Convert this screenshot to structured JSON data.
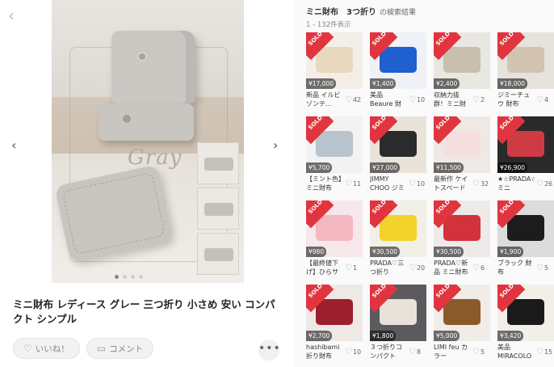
{
  "product": {
    "title": "ミニ財布 レディース グレー 三つ折り 小さめ 安い コンパクト シンプル",
    "photo_text": "Gray",
    "like_label": "いいね！",
    "comment_label": "コメント",
    "more_label": "•••"
  },
  "search": {
    "query": "ミニ財布　3つ折り",
    "suffix": "の検索結果",
    "count": "1 - 132件表示"
  },
  "sold_label": "SOLD",
  "items": [
    {
      "price": "¥17,000",
      "name": "新品 イルビゾンテ...",
      "likes": "42",
      "bg": "#f3efe8",
      "obj": "#e8d8be"
    },
    {
      "price": "¥1,400",
      "name": "美品　Beaure 財布",
      "likes": "10",
      "bg": "#eef1f6",
      "obj": "#1f5fcf"
    },
    {
      "price": "¥2,400",
      "name": "収納力抜群！ミニ財布",
      "likes": "2",
      "bg": "#e9e7e2",
      "obj": "#c8bfae"
    },
    {
      "price": "¥18,000",
      "name": "ジミーチュウ 財布",
      "likes": "4",
      "bg": "#e6e2dc",
      "obj": "#d2c4b0"
    },
    {
      "price": "¥5,700",
      "name": "【ミント色】ミニ財布",
      "likes": "11",
      "bg": "#f2f2f2",
      "obj": "#b8c3cb"
    },
    {
      "price": "¥27,000",
      "name": "JIMMY CHOO ジミーチュウ",
      "likes": "10",
      "bg": "#eae3da",
      "obj": "#2b2b2b"
    },
    {
      "price": "¥11,500",
      "name": "最新作 ケイトスペード",
      "likes": "32",
      "bg": "#eee9e4",
      "obj": "#f6dfe0"
    },
    {
      "price": "¥26,900",
      "name": "★☆PRADA☆★ミニ",
      "likes": "26",
      "bg": "#2a2a2a",
      "obj": "#cf3b45"
    },
    {
      "price": "¥980",
      "name": "【最終値下げ】ひらサイズ",
      "likes": "1",
      "bg": "#f6e7ea",
      "obj": "#f4b8c3"
    },
    {
      "price": "¥30,500",
      "name": "PRADA♡三つ折り",
      "likes": "20",
      "bg": "#f1efe6",
      "obj": "#f2d22b"
    },
    {
      "price": "¥30,500",
      "name": "PRADA♡新品 ミニ財布",
      "likes": "6",
      "bg": "#efeaea",
      "obj": "#d2323c"
    },
    {
      "price": "¥1,900",
      "name": "ブラック 財布",
      "likes": "5",
      "bg": "#dcdcdc",
      "obj": "#1c1c1c"
    },
    {
      "price": "¥2,700",
      "name": "hashibami 折り財布",
      "likes": "10",
      "bg": "#efe9e6",
      "obj": "#9c1f2e"
    },
    {
      "price": "¥1,800",
      "name": "３つ折りコンパクト",
      "likes": "8",
      "bg": "#5c5a5f",
      "obj": "#e8e2da"
    },
    {
      "price": "¥5,000",
      "name": "LIMI feu カラー",
      "likes": "5",
      "bg": "#f0ece8",
      "obj": "#8b5a2b"
    },
    {
      "price": "¥3,420",
      "name": "美品 MIRACOLO",
      "likes": "15",
      "bg": "#f2efe8",
      "obj": "#1a1a1a"
    }
  ]
}
